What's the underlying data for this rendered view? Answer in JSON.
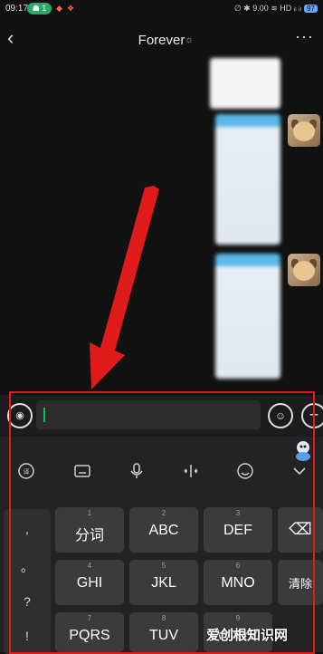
{
  "status": {
    "time": "09:17",
    "badge": "1",
    "right_text": "∅ ✱ 9.00 ≋ HD ᵢₗ ᵢₗ",
    "battery": "97"
  },
  "header": {
    "title": "Forever",
    "more": "···"
  },
  "input": {
    "voice_icon": "voice-icon",
    "emoji_icon": "emoji-icon",
    "plus_icon": "plus-icon"
  },
  "toolbar": {
    "items": [
      "translate-icon",
      "keyboard-icon",
      "mic-icon",
      "cursor-move-icon",
      "emoji-icon",
      "collapse-icon"
    ]
  },
  "keyboard": {
    "side": [
      ",",
      "。",
      "?",
      "!"
    ],
    "rows": [
      [
        {
          "num": "1",
          "label": "分词"
        },
        {
          "num": "2",
          "label": "ABC"
        },
        {
          "num": "3",
          "label": "DEF"
        }
      ],
      [
        {
          "num": "4",
          "label": "GHI"
        },
        {
          "num": "5",
          "label": "JKL"
        },
        {
          "num": "6",
          "label": "MNO"
        }
      ],
      [
        {
          "num": "7",
          "label": "PQRS"
        },
        {
          "num": "8",
          "label": "TUV"
        },
        {
          "num": "9",
          "label": "WXYZ"
        }
      ]
    ],
    "delete_label": "⌫",
    "clear_label": "清除"
  },
  "watermark": "爱创根知识网",
  "colors": {
    "accent": "#07c160",
    "arrow": "#e01b1b"
  }
}
